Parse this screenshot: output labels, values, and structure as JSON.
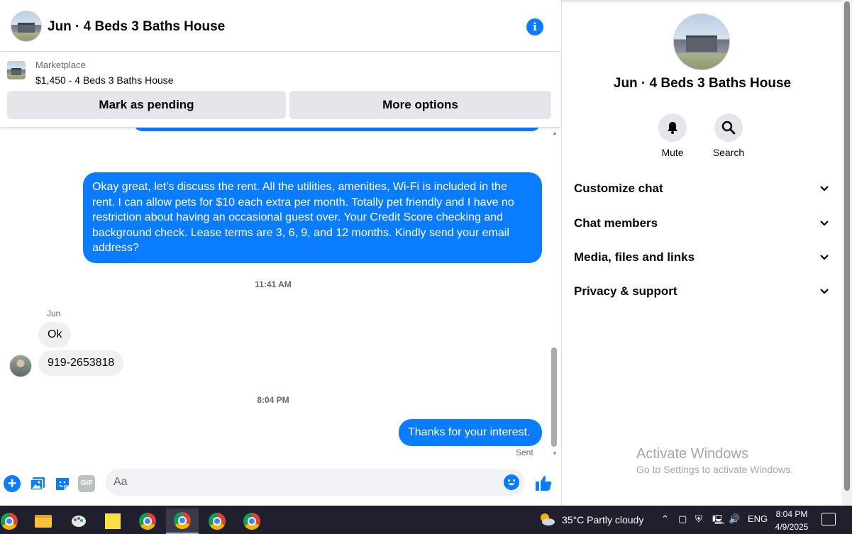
{
  "header": {
    "title": "Jun · 4 Beds 3 Baths House",
    "info_icon": "info-icon"
  },
  "marketplace": {
    "label": "Marketplace",
    "listing": "$1,450 - 4 Beds 3 Baths House",
    "mark_pending": "Mark as pending",
    "more_options": "More options"
  },
  "thread": {
    "long_message": "Okay great, let’s discuss the rent. All the utilities, amenities, Wi-Fi is included in the rent. I can allow pets for $10 each extra per month. Totally pet friendly and I have no restriction about having an occasional guest over. Your Credit Score checking and background check. Lease terms are 3, 6, 9, and 12 months. Kindly send your email address?",
    "time1": "11:41 AM",
    "sender": "Jun",
    "reply1": "Ok",
    "reply2": "919-2653818",
    "time2": "8:04 PM",
    "thanks": "Thanks for your interest.",
    "sent": "Sent"
  },
  "composer": {
    "placeholder": "Aa",
    "gif": "GIF"
  },
  "panel": {
    "title": "Jun · 4 Beds 3 Baths House",
    "mute": "Mute",
    "search": "Search",
    "items": [
      "Customize chat",
      "Chat members",
      "Media, files and links",
      "Privacy & support"
    ]
  },
  "watermark": {
    "line1": "Activate Windows",
    "line2": "Go to Settings to activate Windows."
  },
  "taskbar": {
    "weather": "35°C  Partly cloudy",
    "lang": "ENG",
    "time": "8:04 PM",
    "date": "4/9/2025"
  },
  "colors": {
    "accent": "#0a7cff",
    "bubble_in": "#f0f0f0",
    "taskbar": "#1f1f2e"
  }
}
